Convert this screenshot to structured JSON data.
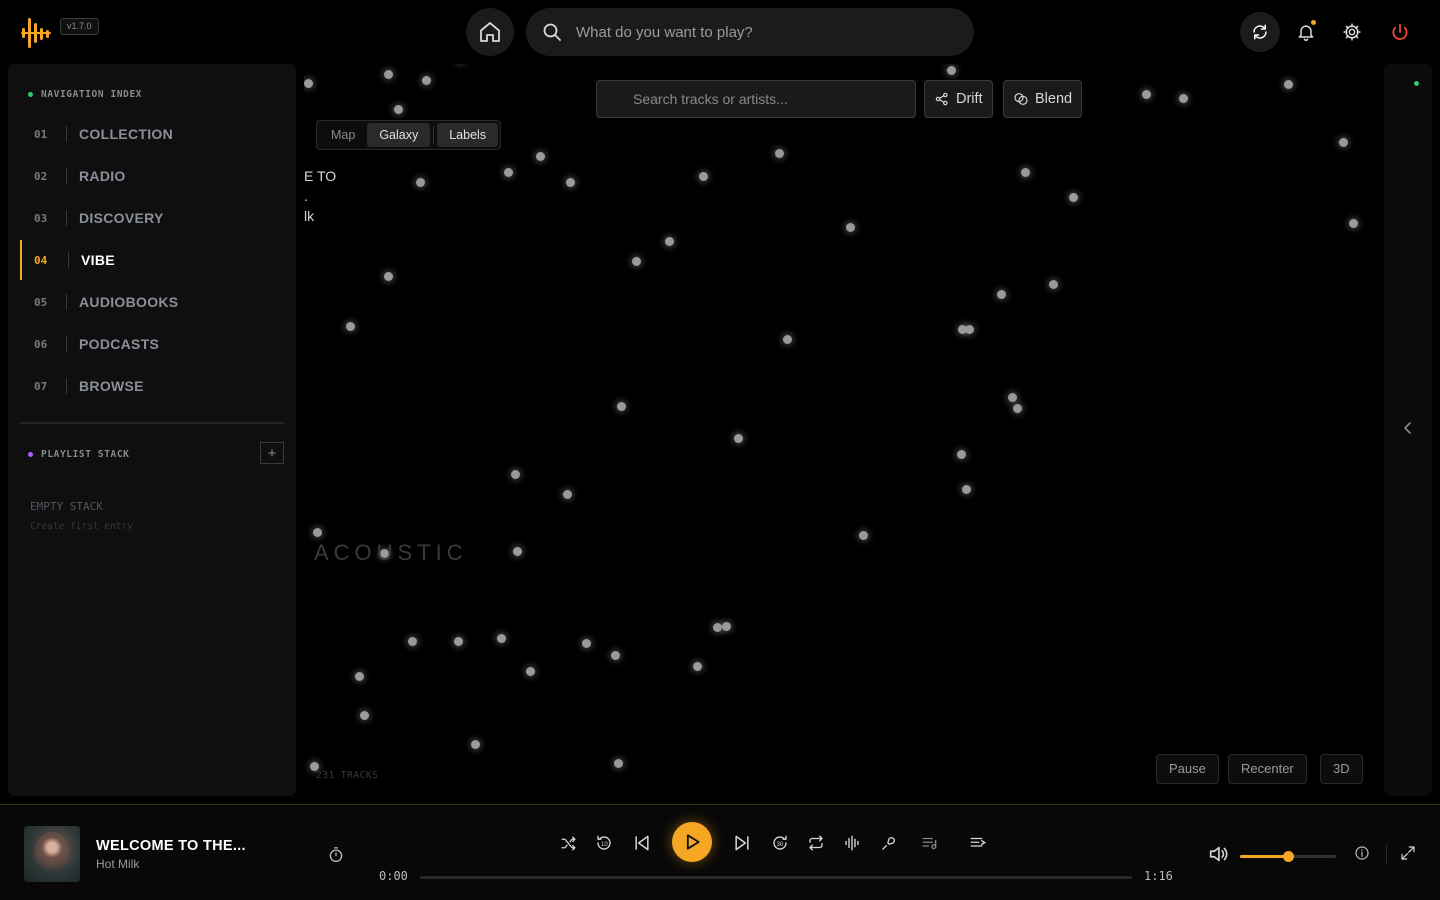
{
  "app": {
    "version": "v1.7.0",
    "logo_icon": "equalizer-bars-logo",
    "accent_color": "#f5a623"
  },
  "header": {
    "search_placeholder": "What do you want to play?",
    "icons": [
      "home-icon",
      "search-icon",
      "sync-icon",
      "bell-icon",
      "gear-icon",
      "power-icon"
    ]
  },
  "sidebar": {
    "nav_title": "NAVIGATION INDEX",
    "items": [
      {
        "num": "01",
        "label": "COLLECTION"
      },
      {
        "num": "02",
        "label": "RADIO"
      },
      {
        "num": "03",
        "label": "DISCOVERY"
      },
      {
        "num": "04",
        "label": "VIBE",
        "active": true
      },
      {
        "num": "05",
        "label": "AUDIOBOOKS"
      },
      {
        "num": "06",
        "label": "PODCASTS"
      },
      {
        "num": "07",
        "label": "BROWSE"
      }
    ],
    "playlist_title": "PLAYLIST STACK",
    "add_label": "+",
    "empty_title": "EMPTY STACK",
    "empty_subtitle": "Create first entry"
  },
  "vibe": {
    "search_placeholder": "Search tracks or artists...",
    "drift_label": "Drift",
    "blend_label": "Blend",
    "view_modes": [
      "Map",
      "Galaxy"
    ],
    "active_view": "Galaxy",
    "labels_toggle": "Labels",
    "fragment_lines": [
      "E TO",
      ".",
      "lk"
    ],
    "cluster_label": "ACOUSTIC",
    "track_count": "231 TRACKS",
    "pause_label": "Pause",
    "recenter_label": "Recenter",
    "mode_3d_label": "3D"
  },
  "player": {
    "title": "WELCOME TO THE...",
    "artist": "Hot Milk",
    "time_current": "0:00",
    "time_total": "1:16",
    "progress_fraction": 0,
    "volume_fraction": 0.5,
    "icons": [
      "timer-icon",
      "shuffle-icon",
      "rewind-10-icon",
      "previous-icon",
      "play-icon",
      "next-icon",
      "forward-30-icon",
      "repeat-icon",
      "waveform-icon",
      "lyrics-icon",
      "playlist-icon",
      "queue-icon",
      "volume-icon",
      "info-icon",
      "expand-icon"
    ]
  }
}
